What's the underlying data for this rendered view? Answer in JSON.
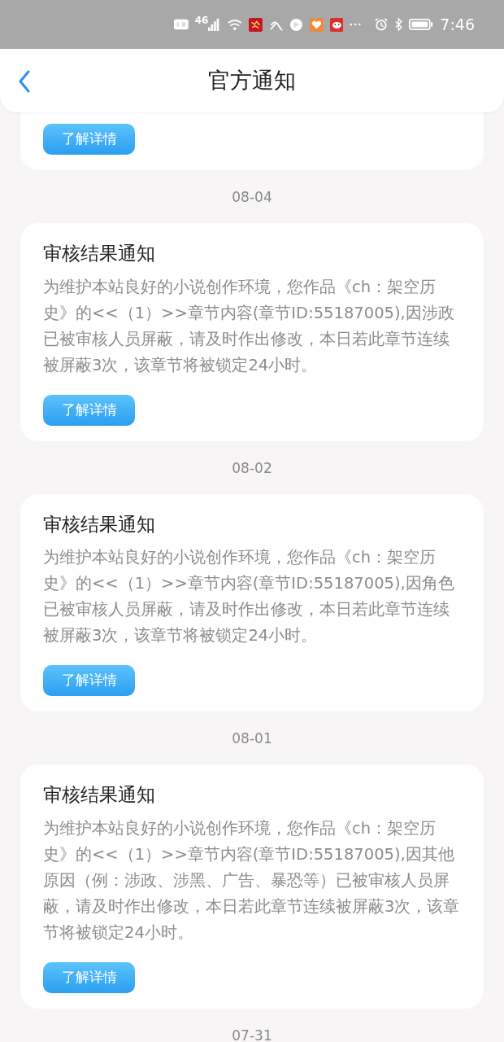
{
  "status_bar": {
    "network": "46",
    "time": "7:46"
  },
  "header": {
    "title": "官方通知"
  },
  "partial_card": {
    "button": "了解详情"
  },
  "notices": [
    {
      "date": "08-04",
      "title": "审核结果通知",
      "body": "为维护本站良好的小说创作环境，您作品《ch：架空历史》的<<（1）>>章节内容(章节ID:55187005),因涉政已被审核人员屏蔽，请及时作出修改，本日若此章节连续被屏蔽3次，该章节将被锁定24小时。",
      "button": "了解详情"
    },
    {
      "date": "08-02",
      "title": "审核结果通知",
      "body": "为维护本站良好的小说创作环境，您作品《ch：架空历史》的<<（1）>>章节内容(章节ID:55187005),因角色已被审核人员屏蔽，请及时作出修改，本日若此章节连续被屏蔽3次，该章节将被锁定24小时。",
      "button": "了解详情"
    },
    {
      "date": "08-01",
      "title": "审核结果通知",
      "body": "为维护本站良好的小说创作环境，您作品《ch：架空历史》的<<（1）>>章节内容(章节ID:55187005),因其他原因（例：涉政、涉黑、广告、暴恐等）已被审核人员屏蔽，请及时作出修改，本日若此章节连续被屏蔽3次，该章节将被锁定24小时。",
      "button": "了解详情"
    }
  ],
  "last_date": "07-31"
}
